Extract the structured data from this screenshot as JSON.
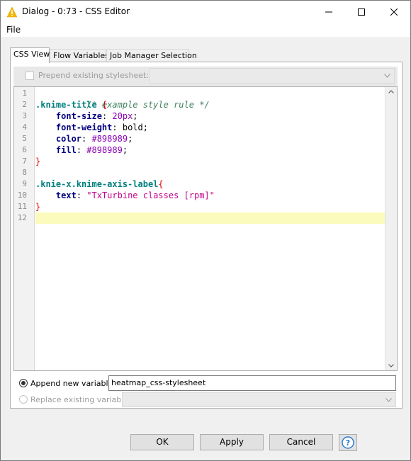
{
  "window": {
    "title": "Dialog - 0:73 - CSS Editor",
    "icon": "knime-warning-triangle-icon",
    "controls": [
      "minimize-icon",
      "maximize-icon",
      "close-icon"
    ]
  },
  "menubar": {
    "items": [
      "File"
    ]
  },
  "tabs": [
    {
      "label": "CSS View",
      "active": true
    },
    {
      "label": "Flow Variables",
      "active": false
    },
    {
      "label": "Job Manager Selection",
      "active": false
    }
  ],
  "prepend": {
    "label": "Prepend existing stylesheet:",
    "checked": false,
    "enabled": false
  },
  "editor": {
    "line_numbers": [
      "1",
      "2",
      "3",
      "4",
      "5",
      "6",
      "7",
      "8",
      "9",
      "10",
      "11",
      "12"
    ],
    "lines": [
      "/* example style rule */",
      ".knime-title {",
      "    font-size: 20px;",
      "    font-weight: bold;",
      "    color: #898989;",
      "    fill: #898989;",
      "}",
      "",
      ".knie-x.knime-axis-label{",
      "    text: \"TxTurbine classes [rpm]\"",
      "}",
      ""
    ],
    "tokens": {
      "l1": "/* example style rule */",
      "l2_sel": ".knime-title",
      "l2_brace": " {",
      "l3_prop": "font-size",
      "l3_colon": ": ",
      "l3_val": "20px",
      "l3_semi": ";",
      "l4_prop": "font-weight",
      "l4_rest": ": bold;",
      "l5_prop": "color",
      "l5_colon": ": ",
      "l5_val": "#898989",
      "l5_semi": ";",
      "l6_prop": "fill",
      "l6_colon": ": ",
      "l6_val": "#898989",
      "l6_semi": ";",
      "l7": "}",
      "l9_sel": ".knie-x.knime-axis-label",
      "l9_brace": "{",
      "l10_prop": "text",
      "l10_colon": ": ",
      "l10_str": "\"TxTurbine classes [rpm]\"",
      "l11": "}"
    },
    "current_line": 12
  },
  "variables": {
    "append_label": "Append new variable:",
    "append_value": "heatmap_css-stylesheet",
    "append_selected": true,
    "replace_label": "Replace existing variable:",
    "replace_enabled": false
  },
  "buttons": {
    "ok": "OK",
    "apply": "Apply",
    "cancel": "Cancel",
    "help_icon": "help-question-icon"
  },
  "colors": {
    "comment": "#3f7f5f",
    "selector": "#007f7f",
    "brace": "#e30000",
    "property": "#00007f",
    "value": "#8a00b3",
    "string": "#c3008a",
    "current_line": "#fbfbbd"
  }
}
